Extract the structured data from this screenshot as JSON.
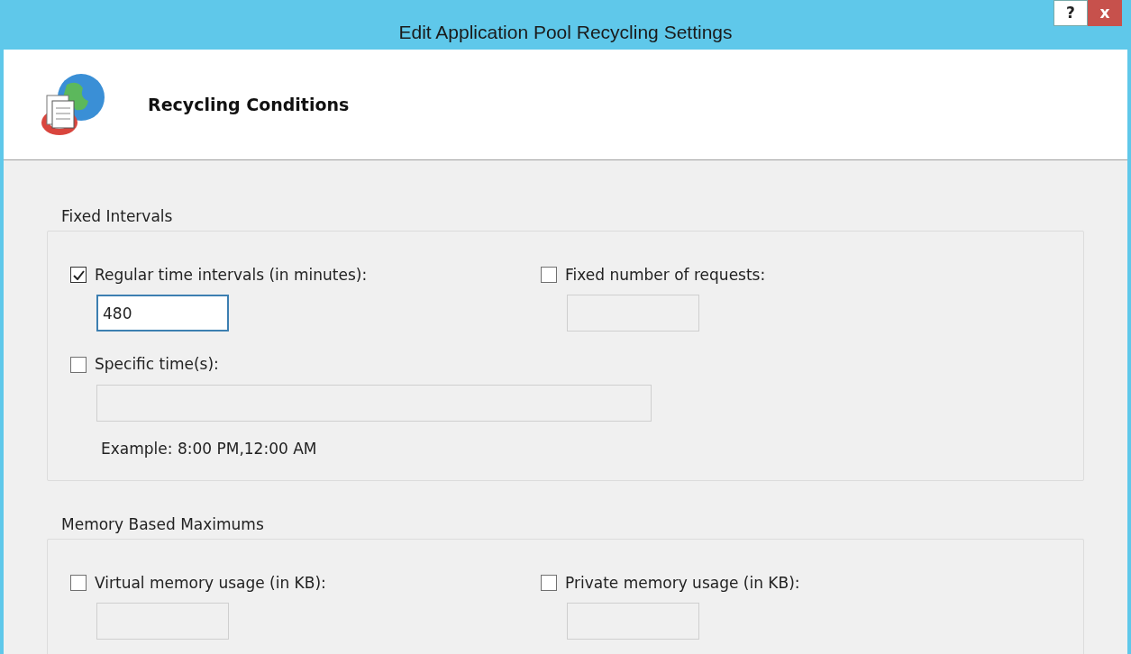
{
  "window": {
    "title": "Edit Application Pool Recycling Settings",
    "help_button": "?",
    "close_button": "x"
  },
  "header": {
    "title": "Recycling Conditions"
  },
  "groups": [
    {
      "title": "Fixed Intervals",
      "rows": [
        [
          {
            "label": "Regular time intervals (in minutes):",
            "checked": true,
            "value": "480"
          },
          {
            "label": "Fixed number of requests:",
            "checked": false
          }
        ],
        [
          {
            "label": "Specific time(s):",
            "checked": false,
            "note": "Example: 8:00 PM,12:00 AM"
          }
        ]
      ]
    },
    {
      "title": "Memory Based Maximums",
      "rows": [
        [
          {
            "label": "Virtual memory usage (in KB):",
            "checked": false
          },
          {
            "label": "Private memory usage (in KB):",
            "checked": false
          }
        ]
      ]
    }
  ]
}
